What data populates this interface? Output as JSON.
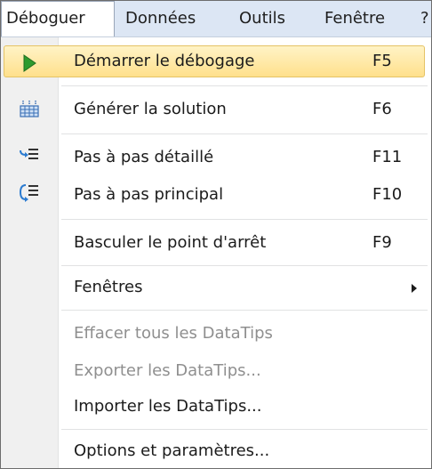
{
  "menubar": {
    "items": [
      {
        "label": "Déboguer"
      },
      {
        "label": "Données"
      },
      {
        "label": "Outils"
      },
      {
        "label": "Fenêtre"
      },
      {
        "label": "?"
      }
    ]
  },
  "menu": {
    "items": [
      {
        "label": "Démarrer le débogage",
        "shortcut": "F5",
        "icon": "play-icon"
      },
      {
        "label": "Générer la solution",
        "shortcut": "F6",
        "icon": "build-solution-icon"
      },
      {
        "label": "Pas à pas détaillé",
        "shortcut": "F11",
        "icon": "step-into-icon"
      },
      {
        "label": "Pas à pas principal",
        "shortcut": "F10",
        "icon": "step-over-icon"
      },
      {
        "label": "Basculer le point d'arrêt",
        "shortcut": "F9"
      },
      {
        "label": "Fenêtres",
        "submenu": true
      },
      {
        "label": "Effacer tous les DataTips",
        "disabled": true
      },
      {
        "label": "Exporter les DataTips...",
        "disabled": true
      },
      {
        "label": "Importer les DataTips..."
      },
      {
        "label": "Options et paramètres..."
      }
    ]
  },
  "colors": {
    "menubar_bg": "#dce6f4",
    "gutter_bg": "#f0f0f0",
    "highlight": "#ffe08c",
    "disabled_text": "#8f8f8f",
    "play_green": "#2e9a2e"
  }
}
